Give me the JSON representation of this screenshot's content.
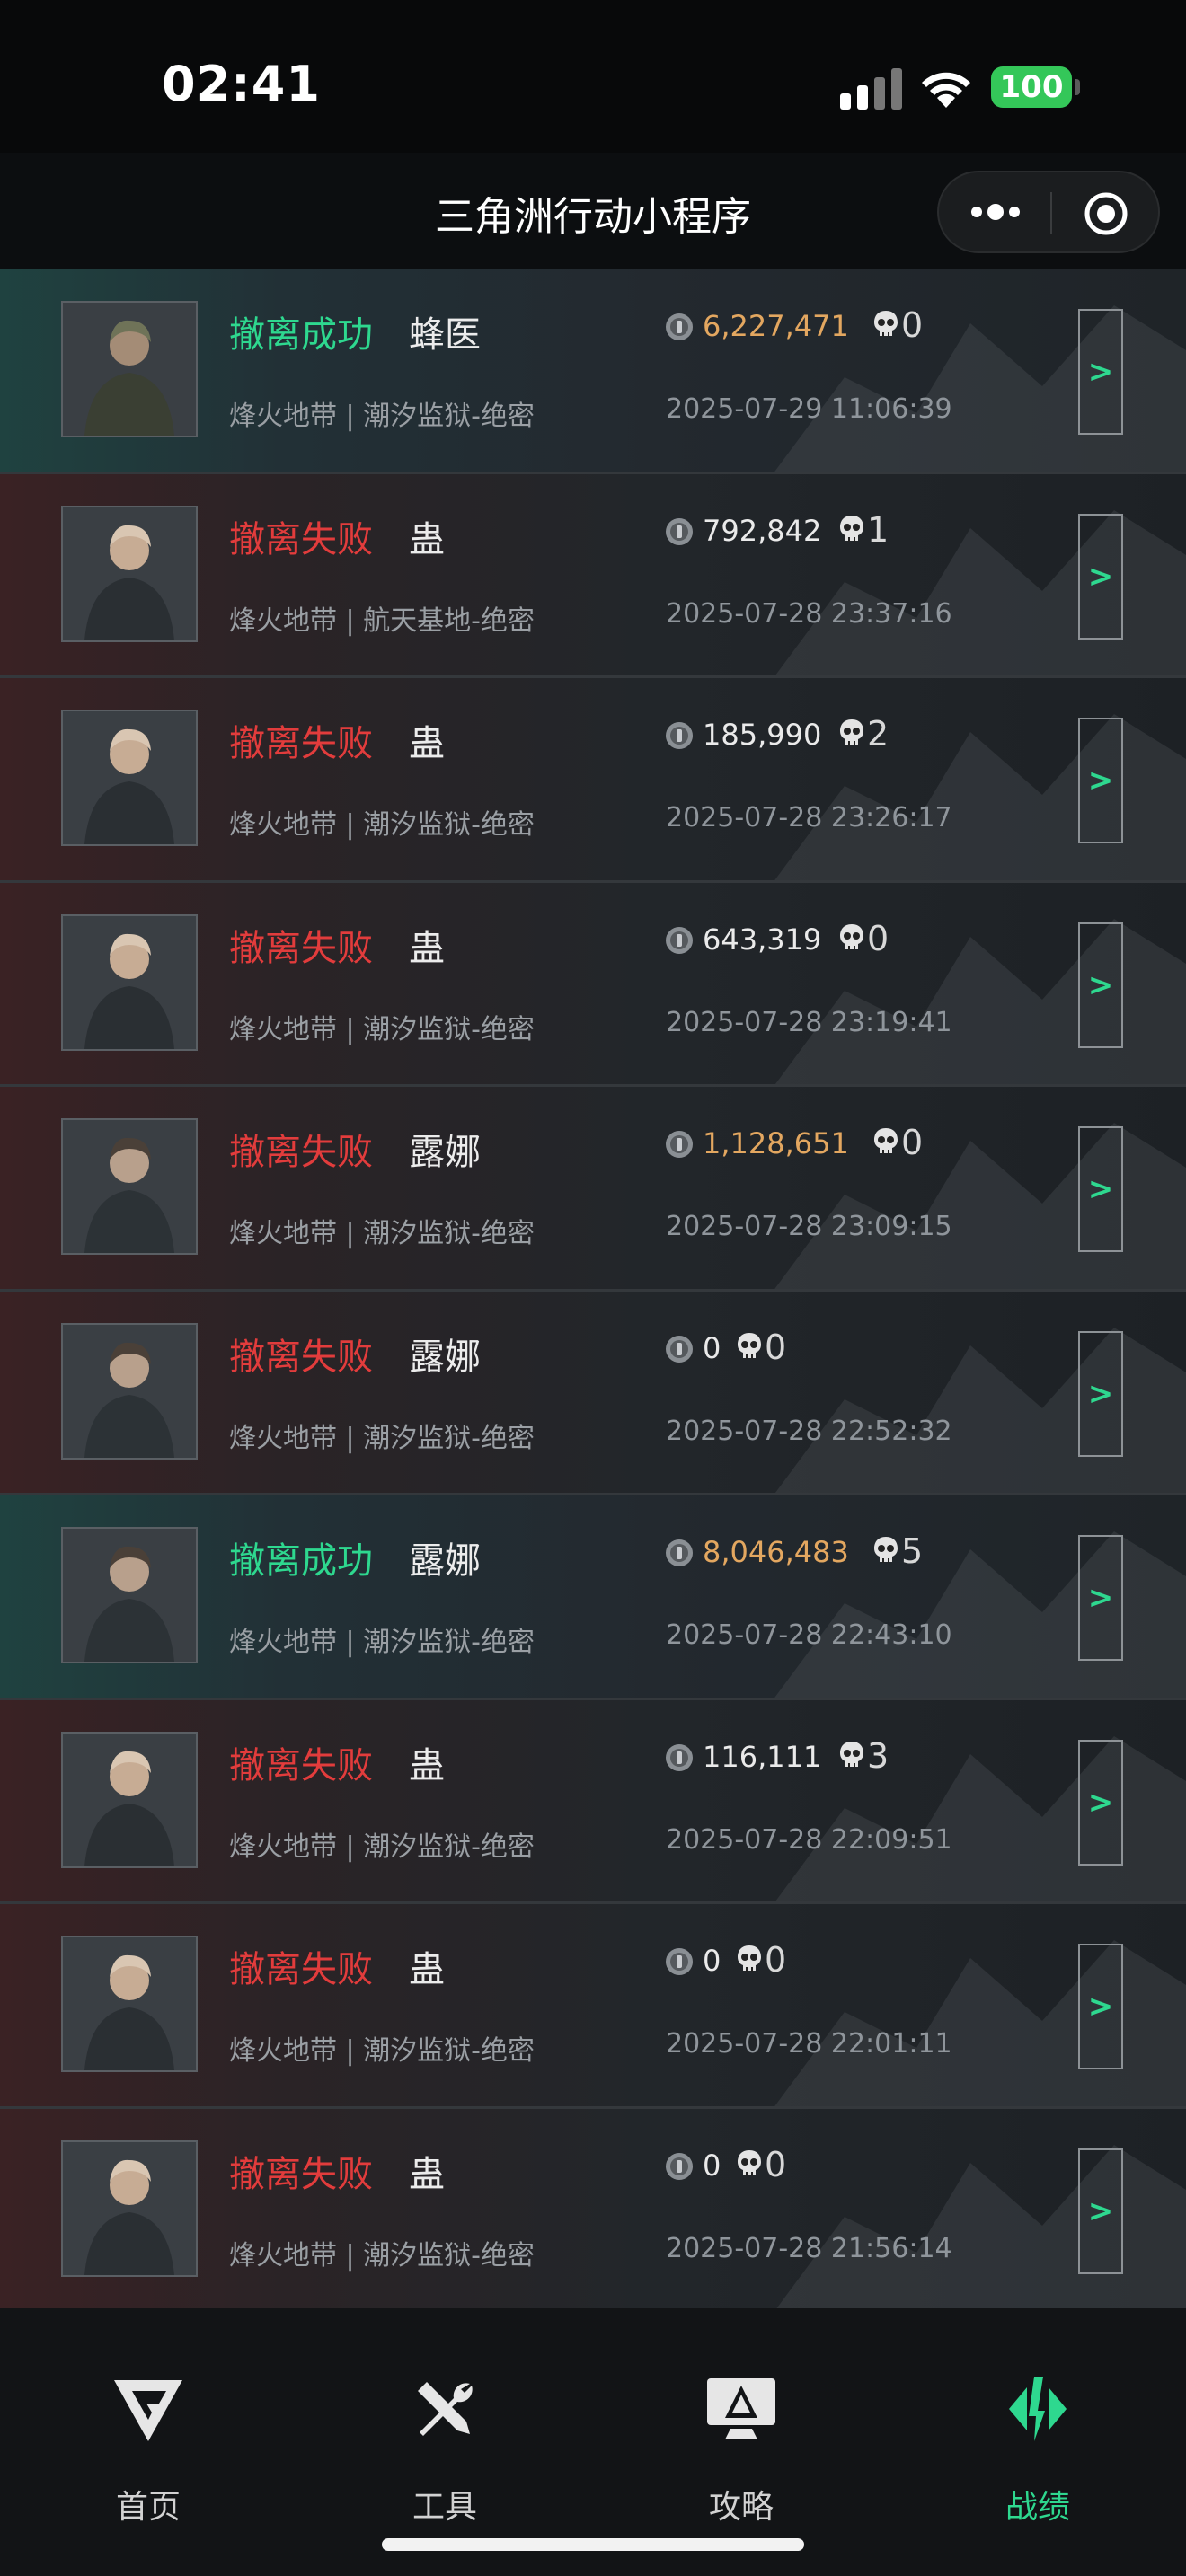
{
  "status_bar": {
    "time": "02:41",
    "battery": "100"
  },
  "nav": {
    "title": "三角洲行动小程序"
  },
  "records": [
    {
      "result": "撤离成功",
      "status": "success",
      "operator": "蜂医",
      "map": "烽火地带 | 潮汐监狱-绝密",
      "value": "6,227,471",
      "kills": "0",
      "time": "2025-07-29 11:06:39",
      "avatar": "bee-doctor"
    },
    {
      "result": "撤离失败",
      "status": "fail",
      "operator": "蛊",
      "map": "烽火地带 | 航天基地-绝密",
      "value": "792,842",
      "kills": "1",
      "time": "2025-07-28 23:37:16",
      "avatar": "gu"
    },
    {
      "result": "撤离失败",
      "status": "fail",
      "operator": "蛊",
      "map": "烽火地带 | 潮汐监狱-绝密",
      "value": "185,990",
      "kills": "2",
      "time": "2025-07-28 23:26:17",
      "avatar": "gu"
    },
    {
      "result": "撤离失败",
      "status": "fail",
      "operator": "蛊",
      "map": "烽火地带 | 潮汐监狱-绝密",
      "value": "643,319",
      "kills": "0",
      "time": "2025-07-28 23:19:41",
      "avatar": "gu"
    },
    {
      "result": "撤离失败",
      "status": "fail",
      "operator": "露娜",
      "map": "烽火地带 | 潮汐监狱-绝密",
      "value": "1,128,651",
      "kills": "0",
      "time": "2025-07-28 23:09:15",
      "avatar": "luna"
    },
    {
      "result": "撤离失败",
      "status": "fail",
      "operator": "露娜",
      "map": "烽火地带 | 潮汐监狱-绝密",
      "value": "0",
      "kills": "0",
      "time": "2025-07-28 22:52:32",
      "avatar": "luna"
    },
    {
      "result": "撤离成功",
      "status": "success",
      "operator": "露娜",
      "map": "烽火地带 | 潮汐监狱-绝密",
      "value": "8,046,483",
      "kills": "5",
      "time": "2025-07-28 22:43:10",
      "avatar": "luna"
    },
    {
      "result": "撤离失败",
      "status": "fail",
      "operator": "蛊",
      "map": "烽火地带 | 潮汐监狱-绝密",
      "value": "116,111",
      "kills": "3",
      "time": "2025-07-28 22:09:51",
      "avatar": "gu"
    },
    {
      "result": "撤离失败",
      "status": "fail",
      "operator": "蛊",
      "map": "烽火地带 | 潮汐监狱-绝密",
      "value": "0",
      "kills": "0",
      "time": "2025-07-28 22:01:11",
      "avatar": "gu"
    },
    {
      "result": "撤离失败",
      "status": "fail",
      "operator": "蛊",
      "map": "烽火地带 | 潮汐监狱-绝密",
      "value": "0",
      "kills": "0",
      "time": "2025-07-28 21:56:14",
      "avatar": "gu"
    }
  ],
  "detail_label": ">",
  "tabs": [
    {
      "label": "首页",
      "icon": "delta-logo-icon",
      "active": false
    },
    {
      "label": "工具",
      "icon": "tools-icon",
      "active": false
    },
    {
      "label": "攻略",
      "icon": "guide-monitor-icon",
      "active": false
    },
    {
      "label": "战绩",
      "icon": "battle-record-icon",
      "active": true
    }
  ],
  "colors": {
    "success": "#2ed88f",
    "fail": "#e23c3c",
    "gold": "#e3a760",
    "accent": "#2ed88f"
  }
}
